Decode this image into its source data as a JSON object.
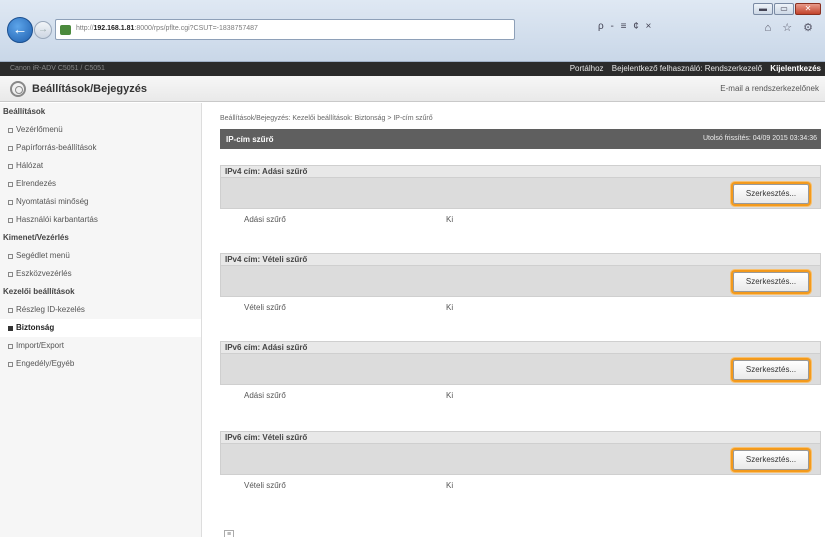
{
  "browser": {
    "url_prefix": "http://",
    "url_host": "192.168.1.81",
    "url_rest": ":8000/rps/pflte.cgi?CSUT=-1838757487",
    "search_glyphs": "ρ - ≡ ¢ ×",
    "tool_glyphs": "⌂ ☆ ⚙",
    "win_min": "▬",
    "win_max": "▭",
    "win_close": "✕"
  },
  "topbar": {
    "device": "Canon iR-ADV C5051 / C5051",
    "links": [
      "Portálhoz",
      "Bejelentkező felhasználó: Rendszerkezelő",
      "Kijelentkezés"
    ]
  },
  "titlebar": {
    "title": "Beállítások/Bejegyzés",
    "mail_link": "E-mail a rendszerkezelőnek"
  },
  "sidebar": {
    "sections": [
      {
        "label": "Beállítások",
        "items": [
          "Vezérlőmenü",
          "Papírforrás-beállítások",
          "Hálózat",
          "Elrendezés",
          "Nyomtatási minőség",
          "Használói karbantartás"
        ]
      },
      {
        "label": "Kimenet/Vezérlés",
        "items": [
          "Segédlet menü",
          "Eszközvezérlés"
        ]
      },
      {
        "label": "Kezelői beállítások",
        "items": [
          "Részleg ID-kezelés",
          "Biztonság",
          "Import/Export",
          "Engedély/Egyéb"
        ]
      }
    ],
    "active": "Biztonság"
  },
  "main": {
    "breadcrumb": "Beállítások/Bejegyzés: Kezelői beállítások: Biztonság > IP-cím szűrő",
    "page_title": "IP-cím szűrő",
    "last_updated": "Utolsó frissítés: 04/09 2015 03:34:36",
    "edit_label": "Szerkesztés...",
    "blocks": [
      {
        "heading": "IPv4 cím: Adási szűrő",
        "key": "Adási szűrő",
        "value": "Ki"
      },
      {
        "heading": "IPv4 cím: Vételi szűrő",
        "key": "Vételi szűrő",
        "value": "Ki"
      },
      {
        "heading": "IPv6 cím: Adási szűrő",
        "key": "Adási szűrő",
        "value": "Ki"
      },
      {
        "heading": "IPv6 cím: Vételi szűrő",
        "key": "Vételi szűrő",
        "value": "Ki"
      }
    ],
    "page_end_glyph": "≡"
  }
}
